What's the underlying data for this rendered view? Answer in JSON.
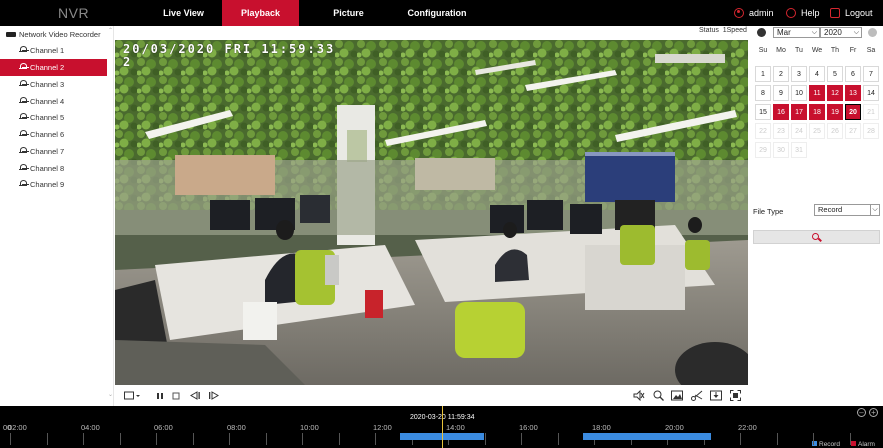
{
  "brand": "NVR",
  "nav": [
    {
      "label": "Live View",
      "active": false
    },
    {
      "label": "Playback",
      "active": true
    },
    {
      "label": "Picture",
      "active": false
    },
    {
      "label": "Configuration",
      "active": false
    }
  ],
  "right": {
    "user": "admin",
    "help": "Help",
    "logout": "Logout"
  },
  "tree": {
    "root": "Network Video Recorder",
    "channels": [
      {
        "label": "Channel 1",
        "active": false
      },
      {
        "label": "Channel 2",
        "active": true
      },
      {
        "label": "Channel 3",
        "active": false
      },
      {
        "label": "Channel 4",
        "active": false
      },
      {
        "label": "Channel 5",
        "active": false
      },
      {
        "label": "Channel 6",
        "active": false
      },
      {
        "label": "Channel 7",
        "active": false
      },
      {
        "label": "Channel 8",
        "active": false
      },
      {
        "label": "Channel 9",
        "active": false
      }
    ]
  },
  "video": {
    "status_label": "Status",
    "speed": "1Speed",
    "osd_date": "20/03/2020  FRI  11:59:33",
    "osd_channel": "2"
  },
  "calendar": {
    "month": "Mar",
    "year": "2020",
    "weekdays": [
      "Su",
      "Mo",
      "Tu",
      "We",
      "Th",
      "Fr",
      "Sa"
    ],
    "weeks": [
      [
        {
          "d": "1",
          "t": "n"
        },
        {
          "d": "2",
          "t": "n"
        },
        {
          "d": "3",
          "t": "n"
        },
        {
          "d": "4",
          "t": "n"
        },
        {
          "d": "5",
          "t": "n"
        },
        {
          "d": "6",
          "t": "n"
        },
        {
          "d": "7",
          "t": "n"
        }
      ],
      [
        {
          "d": "8",
          "t": "n"
        },
        {
          "d": "9",
          "t": "n"
        },
        {
          "d": "10",
          "t": "n"
        },
        {
          "d": "11",
          "t": "r"
        },
        {
          "d": "12",
          "t": "r"
        },
        {
          "d": "13",
          "t": "r"
        },
        {
          "d": "14",
          "t": "n"
        }
      ],
      [
        {
          "d": "15",
          "t": "n"
        },
        {
          "d": "16",
          "t": "r"
        },
        {
          "d": "17",
          "t": "r"
        },
        {
          "d": "18",
          "t": "r"
        },
        {
          "d": "19",
          "t": "r"
        },
        {
          "d": "20",
          "t": "s"
        },
        {
          "d": "21",
          "t": "o"
        }
      ],
      [
        {
          "d": "22",
          "t": "o"
        },
        {
          "d": "23",
          "t": "o"
        },
        {
          "d": "24",
          "t": "o"
        },
        {
          "d": "25",
          "t": "o"
        },
        {
          "d": "26",
          "t": "o"
        },
        {
          "d": "27",
          "t": "o"
        },
        {
          "d": "28",
          "t": "o"
        }
      ],
      [
        {
          "d": "29",
          "t": "o"
        },
        {
          "d": "30",
          "t": "o"
        },
        {
          "d": "31",
          "t": "o"
        }
      ]
    ]
  },
  "search": {
    "file_type_label": "File Type",
    "file_type_value": "Record"
  },
  "timeline": {
    "current": "2020-03-20 11:59:34",
    "labels": [
      "00",
      "02:00",
      "04:00",
      "06:00",
      "08:00",
      "10:00",
      "12:00",
      "14:00",
      "16:00",
      "18:00",
      "20:00",
      "22:00"
    ],
    "legend": {
      "record": "Record",
      "alarm": "Alarm"
    },
    "colors": {
      "record": "#3b8be0",
      "alarm": "#c8102e",
      "cursor": "#e7c23a"
    }
  },
  "colors": {
    "accent": "#c8102e",
    "topbar": "#000000"
  }
}
